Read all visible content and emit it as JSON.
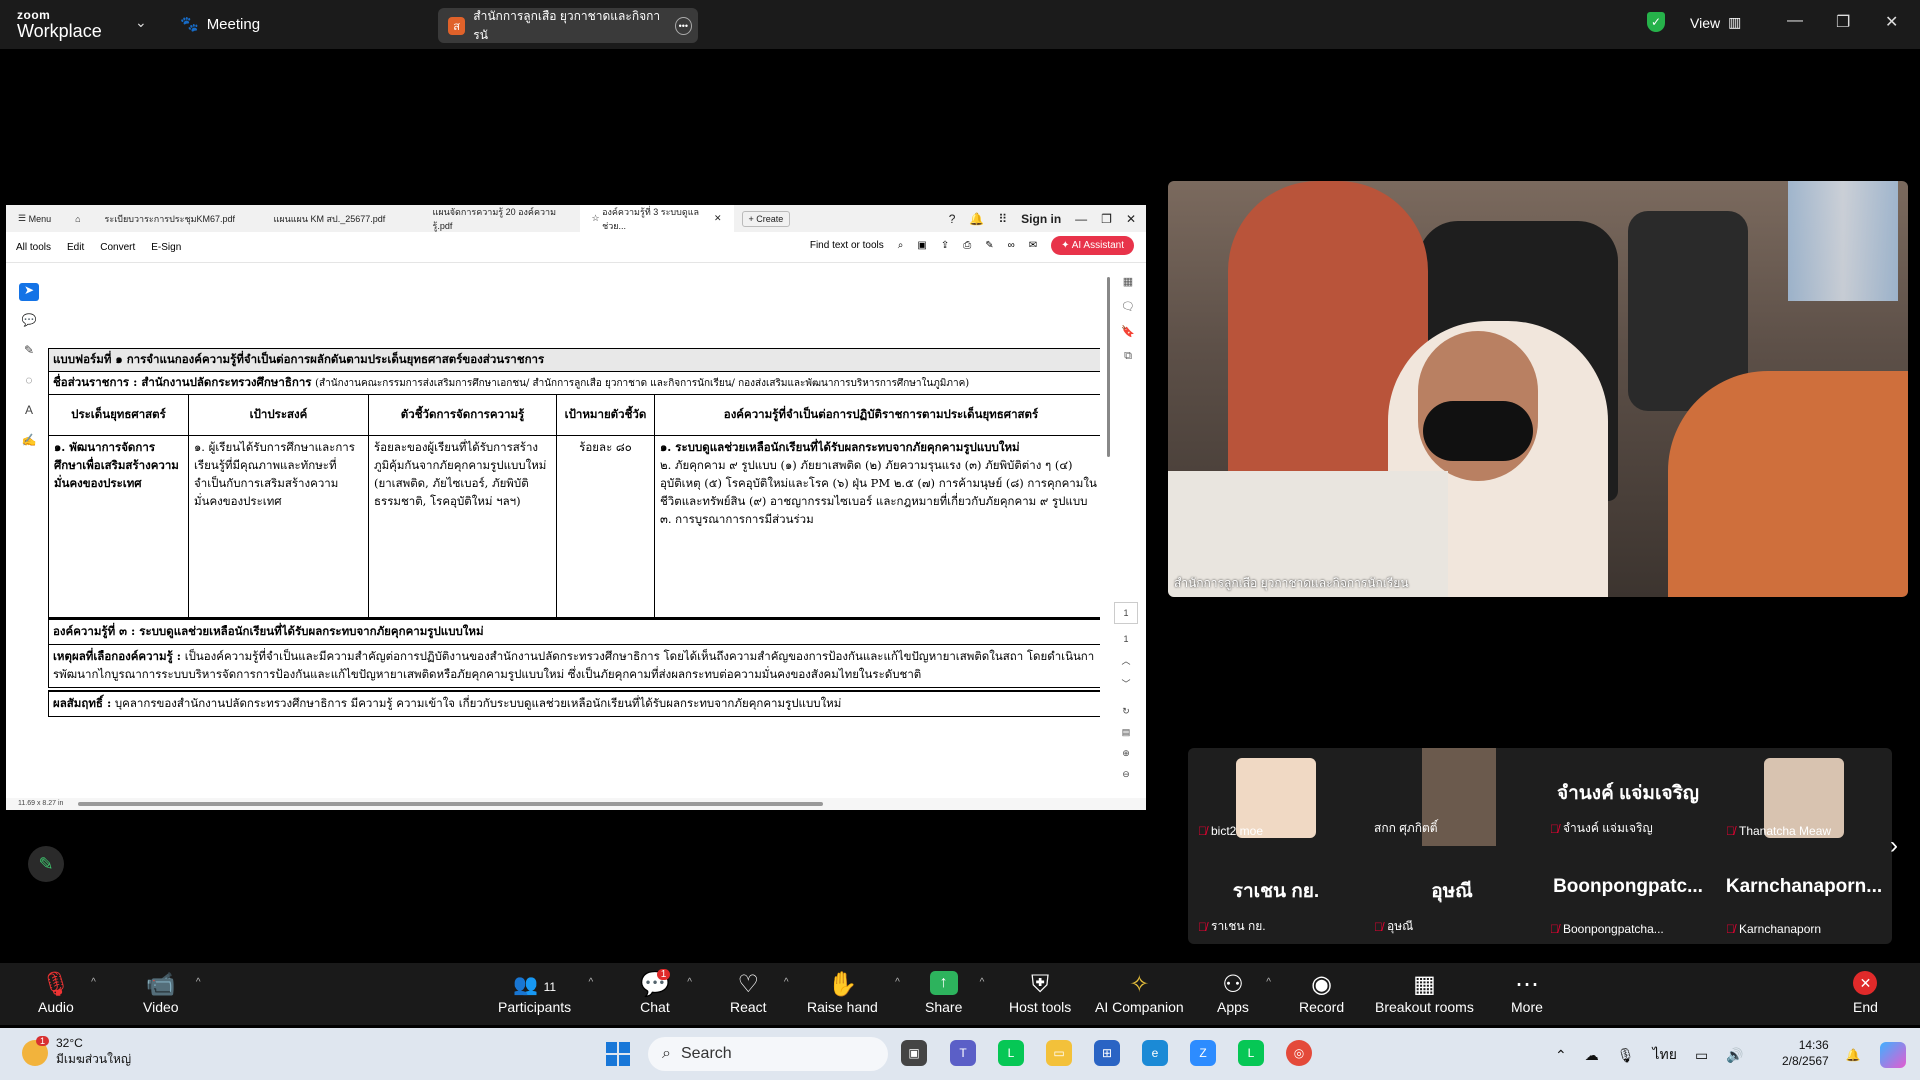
{
  "app": {
    "logo_line1": "zoom",
    "logo_line2": "Workplace",
    "meeting_label": "Meeting",
    "meeting_tab_title": "สำนักการลูกเสือ ยุวกาชาดและกิจการนั",
    "view_label": "View"
  },
  "acrobat": {
    "tabs": [
      {
        "label": "Menu"
      },
      {
        "label": "ระเบียบวาระการประชุมKM67.pdf"
      },
      {
        "label": "แผนแผน KM สป._25677.pdf"
      },
      {
        "label": "แผนจัดการความรู้ 20 องค์ความรู้.pdf"
      },
      {
        "label": "องค์ความรู้ที่ 3 ระบบดูแลช่วย..."
      },
      {
        "label": "Create"
      }
    ],
    "sign_in": "Sign in",
    "tools": [
      "All tools",
      "Edit",
      "Convert",
      "E-Sign"
    ],
    "find_label": "Find text or tools",
    "ai_label": "AI Assistant",
    "page_num": "1",
    "page_total": "1",
    "page_size": "11.69 x 8.27 in"
  },
  "doc": {
    "form_title": "แบบฟอร์มที่ ๑  การจำแนกองค์ความรู้ที่จำเป็นต่อการผลักดันตามประเด็นยุทธศาสตร์ของส่วนราชการ",
    "agency_label": "ชื่อส่วนราชการ : สำนักงานปลัดกระทรวงศึกษาธิการ",
    "agency_note": "(สำนักงานคณะกรรมการส่งเสริมการศึกษาเอกชน/ สำนักการลูกเสือ ยุวกาชาด และกิจการนักเรียน/ กองส่งเสริมและพัฒนาการบริหารการศึกษาในภูมิภาค)",
    "headers": [
      "ประเด็นยุทธศาสตร์",
      "เป้าประสงค์",
      "ตัวชี้วัดการจัดการความรู้",
      "เป้าหมายตัวชี้วัด",
      "องค์ความรู้ที่จำเป็นต่อการปฏิบัติราชการตามประเด็นยุทธศาสตร์"
    ],
    "col1": "๑. พัฒนาการจัดการศึกษาเพื่อเสริมสร้างความมั่นคงของประเทศ",
    "col2": "๑. ผู้เรียนได้รับการศึกษาและการเรียนรู้ที่มีคุณภาพและทักษะที่จำเป็นกับการเสริมสร้างความมั่นคงของประเทศ",
    "col3": "ร้อยละของผู้เรียนที่ได้รับการสร้างภูมิคุ้มกันจากภัยคุกคามรูปแบบใหม่ (ยาเสพติด, ภัยไซเบอร์, ภัยพิบัติธรรมชาติ, โรคอุบัติใหม่ ฯลฯ)",
    "col4": "ร้อยละ ๘๐",
    "col5_1": "๑. ระบบดูแลช่วยเหลือนักเรียนที่ได้รับผลกระทบจากภัยคุกคามรูปแบบใหม่",
    "col5_2": "๒. ภัยคุกคาม ๙ รูปแบบ (๑) ภัยยาเสพติด (๒) ภัยความรุนแรง (๓) ภัยพิบัติต่าง ๆ (๔) อุบัติเหตุ (๕) โรคอุบัติใหม่และโรค (๖) ฝุ่น PM ๒.๕ (๗) การค้ามนุษย์ (๘) การคุกคามในชีวิตและทรัพย์สิน (๙) อาชญากรรมไซเบอร์ และกฎหมายที่เกี่ยวกับภัยคุกคาม ๙ รูปแบบ",
    "col5_3": "๓. การบูรณาการการมีส่วนร่วม",
    "km3": "องค์ความรู้ที่ ๓ : ระบบดูแลช่วยเหลือนักเรียนที่ได้รับผลกระทบจากภัยคุกคามรูปแบบใหม่",
    "reason_label": "เหตุผลที่เลือกองค์ความรู้ :",
    "reason_text": "เป็นองค์ความรู้ที่จำเป็นและมีความสำคัญต่อการปฏิบัติงานของสำนักงานปลัดกระทรวงศึกษาธิการ โดยได้เห็นถึงความสำคัญของการป้องกันและแก้ไขปัญหายาเสพติดในสถา โดยดำเนินการพัฒนากไกบูรณาการระบบบริหารจัดการการป้องกันและแก้ไขปัญหายาเสพติดหรือภัยคุกคามรูปแบบใหม่ ซึ่งเป็นภัยคุกคามที่ส่งผลกระทบต่อความมั่นคงของสังคมไทยในระดับชาติ",
    "result_label": "ผลสัมฤทธิ์ :",
    "result_text": "บุคลากรของสำนักงานปลัดกระทรวงศึกษาธิการ มีความรู้ ความเข้าใจ เกี่ยวกับระบบดูแลช่วยเหลือนักเรียนที่ได้รับผลกระทบจากภัยคุกคามรูปแบบใหม่"
  },
  "video": {
    "caption": "สำนักการลูกเสือ ยุวกาชาดและกิจการนักเรียน"
  },
  "gallery": [
    {
      "name": "bict2 moe",
      "big": ""
    },
    {
      "name": "สกก ศุภกิตติ์",
      "big": ""
    },
    {
      "name": "จำนงค์ แจ่มเจริญ",
      "big": "จำนงค์ แจ่มเจริญ"
    },
    {
      "name": "Thanatcha Meaw",
      "big": ""
    },
    {
      "name": "ราเชน กย.",
      "big": "ราเชน กย."
    },
    {
      "name": "อุษณี",
      "big": "อุษณี"
    },
    {
      "name": "Boonpongpatcha...",
      "big": "Boonpongpatc..."
    },
    {
      "name": "Karnchanaporn",
      "big": "Karnchanaporn..."
    }
  ],
  "toolbar": {
    "audio": "Audio",
    "video": "Video",
    "participants": "Participants",
    "participants_count": "11",
    "chat": "Chat",
    "chat_badge": "1",
    "react": "React",
    "raise_hand": "Raise hand",
    "share": "Share",
    "host_tools": "Host tools",
    "ai_companion": "AI Companion",
    "apps": "Apps",
    "record": "Record",
    "breakout": "Breakout rooms",
    "more": "More",
    "end": "End"
  },
  "taskbar": {
    "temp": "32°C",
    "weather_desc": "มีเมฆส่วนใหญ่",
    "weather_badge": "1",
    "search": "Search",
    "lang": "ไทย",
    "time": "14:36",
    "date": "2/8/2567"
  }
}
